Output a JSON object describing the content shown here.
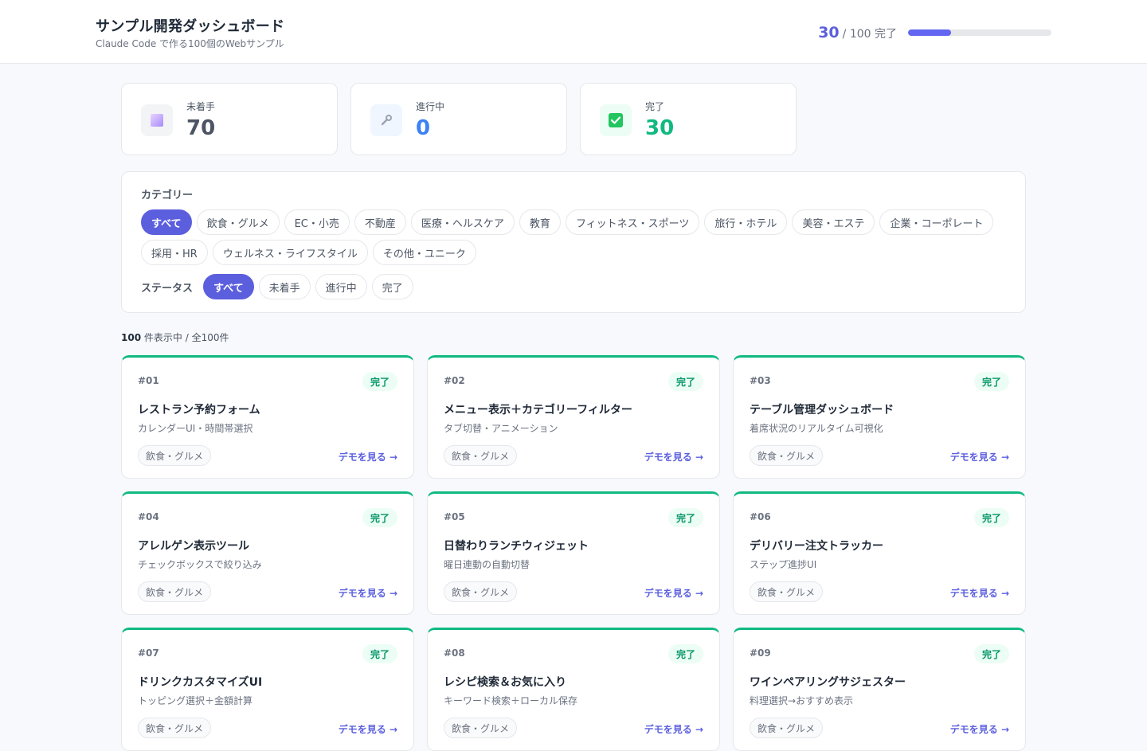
{
  "header": {
    "title": "サンプル開発ダッシュボード",
    "subtitle": "Claude Code で作る100個のWebサンプル",
    "progress_done": "30",
    "progress_rest": "/ 100 完了",
    "progress_fraction": 0.3
  },
  "stats": [
    {
      "label": "未着手",
      "value": "70",
      "icon": "square-icon",
      "color": "#4b5563",
      "bg": "#f3f4f6"
    },
    {
      "label": "進行中",
      "value": "0",
      "icon": "wrench-icon",
      "color": "#3b82f6",
      "bg": "#eff6ff"
    },
    {
      "label": "完了",
      "value": "30",
      "icon": "check-box-icon",
      "color": "#10b981",
      "bg": "#ecfdf5"
    }
  ],
  "filters": {
    "category_label": "カテゴリー",
    "categories": [
      "すべて",
      "飲食・グルメ",
      "EC・小売",
      "不動産",
      "医療・ヘルスケア",
      "教育",
      "フィットネス・スポーツ",
      "旅行・ホテル",
      "美容・エステ",
      "企業・コーポレート",
      "採用・HR",
      "ウェルネス・ライフスタイル",
      "その他・ユニーク"
    ],
    "status_label": "ステータス",
    "statuses": [
      "すべて",
      "未着手",
      "進行中",
      "完了"
    ]
  },
  "count": {
    "shown": "100",
    "text": "件表示中 / 全100件"
  },
  "cards": [
    {
      "num": "#01",
      "badge": "完了",
      "title": "レストラン予約フォーム",
      "desc": "カレンダーUI・時間帯選択",
      "tag": "飲食・グルメ",
      "link": "デモを見る →"
    },
    {
      "num": "#02",
      "badge": "完了",
      "title": "メニュー表示＋カテゴリーフィルター",
      "desc": "タブ切替・アニメーション",
      "tag": "飲食・グルメ",
      "link": "デモを見る →"
    },
    {
      "num": "#03",
      "badge": "完了",
      "title": "テーブル管理ダッシュボード",
      "desc": "着席状況のリアルタイム可視化",
      "tag": "飲食・グルメ",
      "link": "デモを見る →"
    },
    {
      "num": "#04",
      "badge": "完了",
      "title": "アレルゲン表示ツール",
      "desc": "チェックボックスで絞り込み",
      "tag": "飲食・グルメ",
      "link": "デモを見る →"
    },
    {
      "num": "#05",
      "badge": "完了",
      "title": "日替わりランチウィジェット",
      "desc": "曜日連動の自動切替",
      "tag": "飲食・グルメ",
      "link": "デモを見る →"
    },
    {
      "num": "#06",
      "badge": "完了",
      "title": "デリバリー注文トラッカー",
      "desc": "ステップ進捗UI",
      "tag": "飲食・グルメ",
      "link": "デモを見る →"
    },
    {
      "num": "#07",
      "badge": "完了",
      "title": "ドリンクカスタマイズUI",
      "desc": "トッピング選択＋金額計算",
      "tag": "飲食・グルメ",
      "link": "デモを見る →"
    },
    {
      "num": "#08",
      "badge": "完了",
      "title": "レシピ検索＆お気に入り",
      "desc": "キーワード検索＋ローカル保存",
      "tag": "飲食・グルメ",
      "link": "デモを見る →"
    },
    {
      "num": "#09",
      "badge": "完了",
      "title": "ワインペアリングサジェスター",
      "desc": "料理選択→おすすめ表示",
      "tag": "飲食・グルメ",
      "link": "デモを見る →"
    }
  ]
}
